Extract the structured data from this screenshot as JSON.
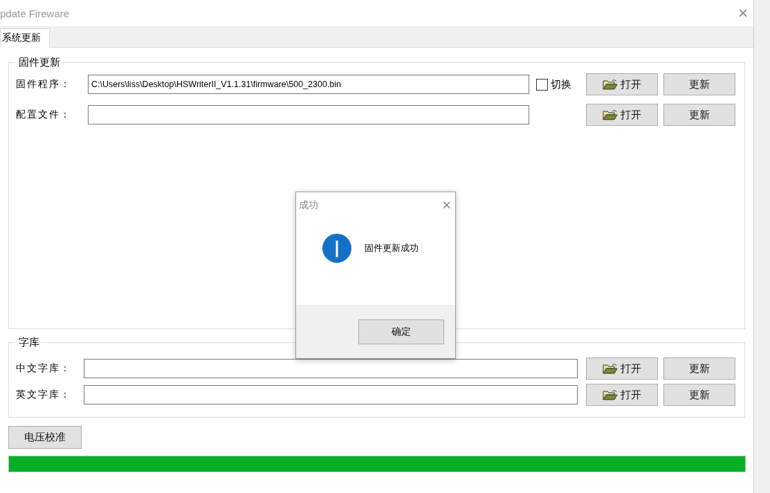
{
  "window": {
    "title": "pdate Fireware",
    "close": "×"
  },
  "tabs": [
    {
      "label": "系统更新",
      "selected": true
    }
  ],
  "firmware_group": {
    "title": "固件更新",
    "rows": [
      {
        "label": "固件程序：",
        "value": "C:\\Users\\liss\\Desktop\\HSWriterII_V1.1.31\\firmware\\500_2300.bin",
        "toggle": {
          "label": "切换",
          "checked": false
        },
        "open": "打开",
        "update": "更新"
      },
      {
        "label": "配置文件：",
        "value": "",
        "open": "打开",
        "update": "更新"
      }
    ]
  },
  "font_group": {
    "title": "字库",
    "rows": [
      {
        "label": "中文字库：",
        "value": "",
        "open": "打开",
        "update": "更新"
      },
      {
        "label": "英文字库：",
        "value": "",
        "open": "打开",
        "update": "更新"
      }
    ]
  },
  "calibrate_button": "电压校准",
  "progress": {
    "level": 1
  },
  "dialog": {
    "title": "成功",
    "close": "×",
    "message": "固件更新成功",
    "ok": "确定"
  }
}
